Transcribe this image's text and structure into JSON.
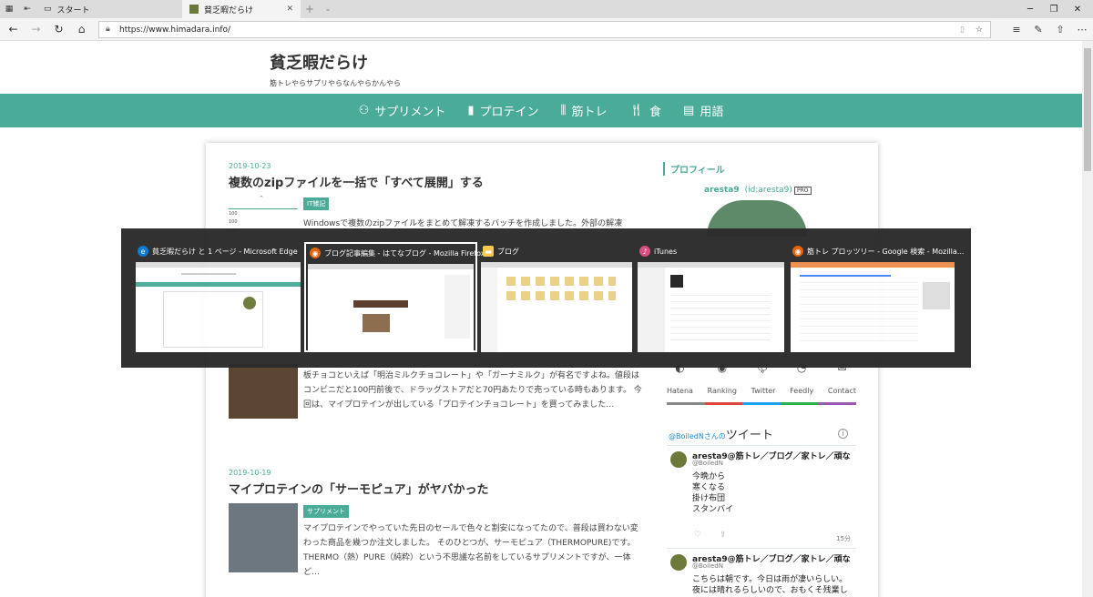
{
  "browser": {
    "tabs": [
      {
        "label": "スタート",
        "active": false
      },
      {
        "label": "貧乏暇だらけ",
        "active": true
      }
    ],
    "new_tab_glyph": "+",
    "url": "https://www.himadara.info/"
  },
  "site": {
    "title": "貧乏暇だらけ",
    "description": "筋トレやらサプリやらなんやらかんやら",
    "nav": [
      {
        "label": "サプリメント",
        "icon": "supplement-icon"
      },
      {
        "label": "プロテイン",
        "icon": "protein-icon"
      },
      {
        "label": "筋トレ",
        "icon": "dumbbell-icon"
      },
      {
        "label": "食",
        "icon": "utensils-icon"
      },
      {
        "label": "用語",
        "icon": "book-icon"
      }
    ]
  },
  "entries": [
    {
      "date": "2019-10-23",
      "title": "複数のzipファイルを一括で「すべて展開」する",
      "category": "IT雑記",
      "excerpt_line1": "Windowsで複数のzipファイルをまとめて解凍するバッチを作成しました。外部の解凍",
      "thumb_lines": [
        "^",
        "100",
        "100",
        "100"
      ]
    },
    {
      "date": "",
      "title": "",
      "category": "",
      "excerpt": "板チョコといえば「明治ミルクチョコレート」や「ガーナミルク」が有名ですよね。値段はコンビニだと100円前後で、ドラッグストアだと70円あたりで売っている時もあります。 今回は、マイプロテインが出している「プロテインチョコレート」を買ってみました…"
    },
    {
      "date": "2019-10-19",
      "title": "マイプロテインの「サーモピュア」がヤバかった",
      "category": "サプリメント",
      "excerpt": "マイプロテインでやっていた先日のセールで色々と割安になってたので、普段は買わない変わった商品を幾つか注文しました。 そのひとつが、サーモピュア（THERMOPURE)です。 THERMO（熱）PURE（純粋）という不思議な名前をしているサプリメントですが、一体ど…"
    }
  ],
  "sidebar": {
    "profile_heading": "プロフィール",
    "user_name": "aresta9",
    "user_id": "(id:aresta9)",
    "pro_badge": "PRO",
    "social": [
      {
        "label": "Hatena",
        "icon": "hatena-icon",
        "color": "#888888"
      },
      {
        "label": "Ranking",
        "icon": "globe-icon",
        "color": "#e0453b"
      },
      {
        "label": "Twitter",
        "icon": "twitter-icon",
        "color": "#1da1f2"
      },
      {
        "label": "Feedly",
        "icon": "rss-icon",
        "color": "#2bb24c"
      },
      {
        "label": "Contact",
        "icon": "mail-icon",
        "color": "#9b59b6"
      }
    ],
    "twitter_widget": {
      "handle": "@BoiledN",
      "suffix": "さんの",
      "title": "ツイート",
      "tweets": [
        {
          "name": "aresta9@筋トレ／ブログ／家トレ／頑な",
          "handle": "@BoiledN",
          "text": [
            "今晩から",
            "寒くなる",
            "掛け布団",
            "スタンバイ"
          ],
          "time": "15分"
        },
        {
          "name": "aresta9@筋トレ／ブログ／家トレ／頑な",
          "handle": "@BoiledN",
          "text": [
            "こちらは朝です。今日は雨が凄いらしい。",
            "夜には晴れるらしいので、おもくそ残業し"
          ],
          "time": ""
        }
      ]
    }
  },
  "task_switcher": {
    "windows": [
      {
        "title": "貧乏暇だらけ と 1 ページ - Microsoft Edge",
        "icon": "edge-icon",
        "color": "#0078d7",
        "selected": false
      },
      {
        "title": "ブログ記事編集 - はてなブログ - Mozilla Firefox",
        "icon": "firefox-icon",
        "color": "#e66000",
        "selected": true
      },
      {
        "title": "ブログ",
        "icon": "folder-icon",
        "color": "#f2c94c",
        "selected": false
      },
      {
        "title": "iTunes",
        "icon": "itunes-icon",
        "color": "#d9487d",
        "selected": false
      },
      {
        "title": "筋トレ プロッツリー - Google 検索 - Mozilla...",
        "icon": "firefox-icon",
        "color": "#e66000",
        "selected": false
      }
    ]
  }
}
